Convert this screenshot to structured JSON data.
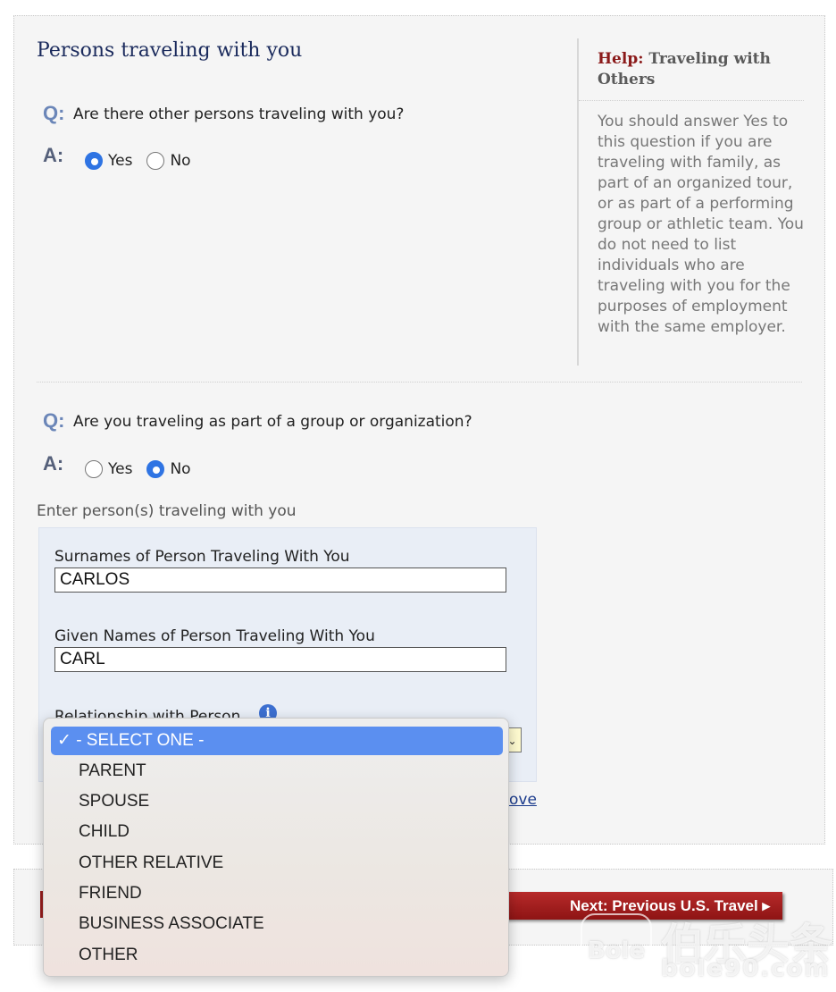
{
  "section_title": "Persons traveling with you",
  "q1": {
    "q_letter": "Q:",
    "a_letter": "A:",
    "question": "Are there other persons traveling with you?",
    "yes": "Yes",
    "no": "No",
    "selected": "Yes"
  },
  "q2": {
    "q_letter": "Q:",
    "a_letter": "A:",
    "question": "Are you traveling as part of a group or organization?",
    "yes": "Yes",
    "no": "No",
    "selected": "No"
  },
  "help": {
    "prefix": "Help:",
    "title": "Traveling with Others",
    "body": "You should answer Yes to this question if you are traveling with family, as part of an organized tour, or as part of a performing group or athletic team. You do not need to list individuals who are traveling with you for the purposes of employment with the same employer."
  },
  "persons": {
    "enter_label": "Enter person(s) traveling with you",
    "surname_label": "Surnames of Person Traveling With You",
    "surname_value": "CARLOS",
    "given_label": "Given Names of Person Traveling With You",
    "given_value": "CARL",
    "relationship_label": "Relationship with Person",
    "remove_link_visible": "ove"
  },
  "dropdown": {
    "selected": "- SELECT ONE -",
    "check": "✓",
    "options": [
      "PARENT",
      "SPOUSE",
      "CHILD",
      "OTHER RELATIVE",
      "FRIEND",
      "BUSINESS ASSOCIATE",
      "OTHER"
    ]
  },
  "nav": {
    "next_label": "Next: Previous U.S. Travel",
    "next_arrow": "▸"
  },
  "watermark": {
    "logo": "Bole",
    "cn": "伯乐头条",
    "url": "bole90.com"
  },
  "colors": {
    "accent_red": "#9a1d1d",
    "select_blue": "#5b8ff0",
    "title_navy": "#1a2a5c"
  }
}
